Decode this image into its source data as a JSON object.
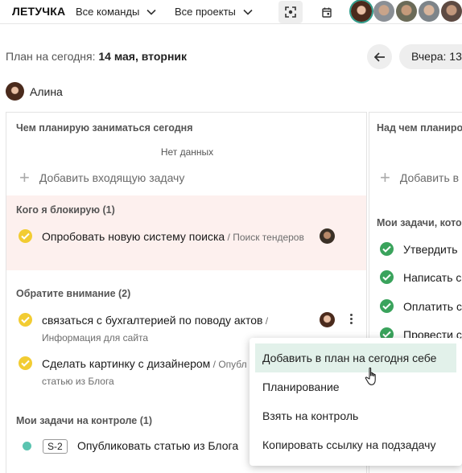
{
  "topbar": {
    "logo": "ЛЕТУЧКА",
    "teams_dropdown": "Все команды",
    "projects_dropdown": "Все проекты",
    "accent": "#2e9c8a"
  },
  "header": {
    "date_prefix": "План на сегодня:",
    "date_value": "14 мая, вторник",
    "prev_label": "Вчера: 13"
  },
  "user": {
    "name": "Алина"
  },
  "today_panel": {
    "title": "Чем планирую заниматься сегодня",
    "empty_text": "Нет данных",
    "add_task": "Добавить входящую задачу",
    "blocking": {
      "title": "Кого я блокирую (1)",
      "tasks": [
        {
          "title": "Опробовать новую систему поиска",
          "project_sep": " / ",
          "project": "Поиск тендеров",
          "status_color": "#f2cc32"
        }
      ]
    },
    "attention": {
      "title": "Обратите внимание (2)",
      "tasks": [
        {
          "title": "связаться с бухгалтерией по поводу актов",
          "project_sep": " / ",
          "project": "Информация для сайта",
          "status_color": "#f2cc32"
        },
        {
          "title": "Сделать картинку с дизайнером",
          "project_sep": " / ",
          "project": "Опубл",
          "project2": "статью из Блога",
          "status_color": "#f2cc32"
        }
      ]
    },
    "control": {
      "title": "Мои задачи на контроле (1)",
      "tasks": [
        {
          "tag": "S-2",
          "title": "Опубликовать статью из Блога",
          "dot_color": "#5bc4b0"
        }
      ]
    }
  },
  "yesterday_panel": {
    "title": "Над чем планиро",
    "add_task": "Добавить в",
    "section": "Мои задачи, кото",
    "tasks": [
      {
        "title": "Утвердить",
        "status_color": "#3aa35c"
      },
      {
        "title": "Написать с",
        "status_color": "#3aa35c"
      },
      {
        "title": "Оплатить с",
        "status_color": "#3aa35c"
      },
      {
        "title": "Провести с",
        "status_color": "#3aa35c"
      }
    ]
  },
  "context_menu": {
    "items": [
      "Добавить в план на сегодня себе",
      "Планирование",
      "Взять на контроль",
      "Копировать ссылку на подзадачу"
    ]
  }
}
